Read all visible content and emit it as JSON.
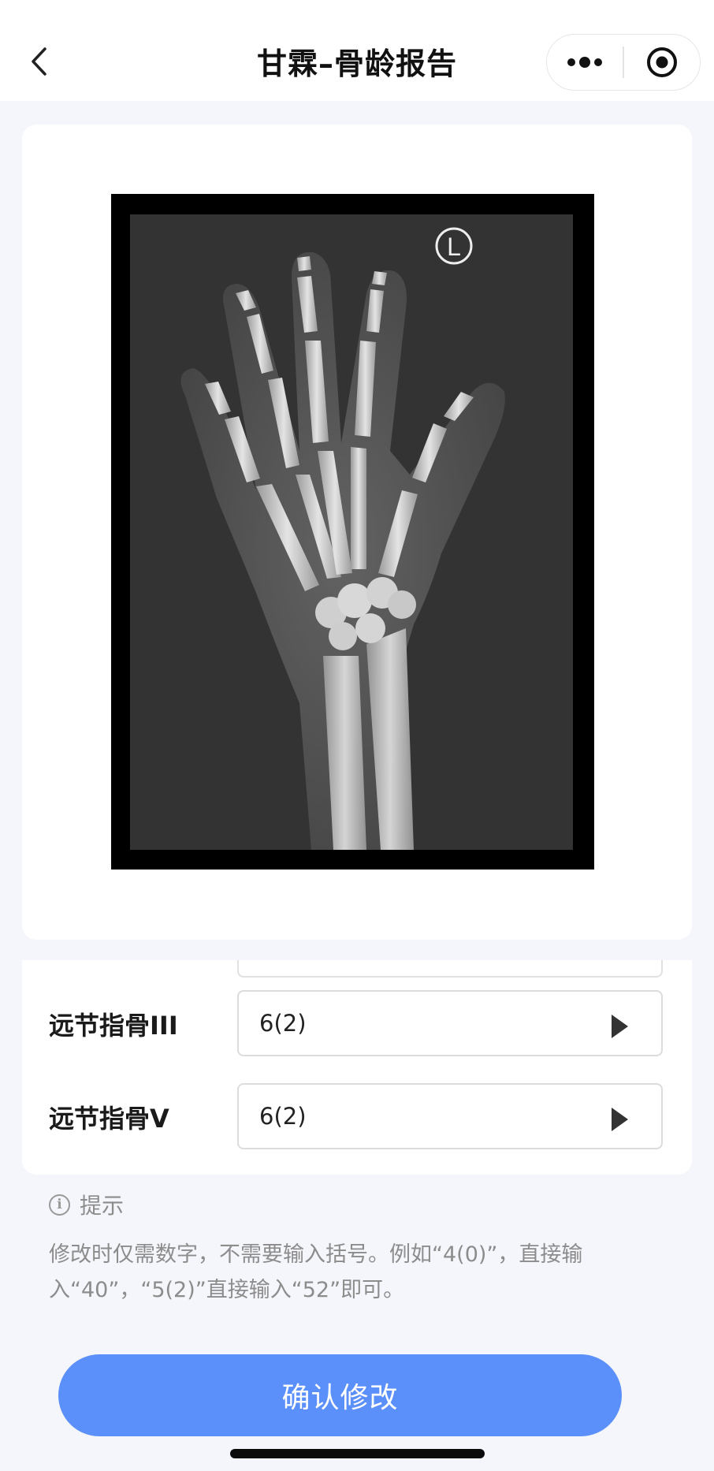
{
  "header": {
    "title": "甘霖–骨龄报告"
  },
  "xray": {
    "side_marker": "L"
  },
  "form": {
    "rows": [
      {
        "label": "远节指骨III",
        "value": "6(2)"
      },
      {
        "label": "远节指骨V",
        "value": "6(2)"
      }
    ]
  },
  "tip": {
    "title": "提示",
    "body": "修改时仅需数字，不需要输入括号。例如“4(0)”，直接输入“40”，“5(2)”直接输入“52”即可。"
  },
  "actions": {
    "confirm_label": "确认修改"
  },
  "colors": {
    "accent": "#5b8ff9",
    "background": "#f5f6fb"
  },
  "icons": [
    "back-chevron-icon",
    "more-dots-icon",
    "target-icon",
    "play-arrow-icon",
    "info-icon"
  ]
}
